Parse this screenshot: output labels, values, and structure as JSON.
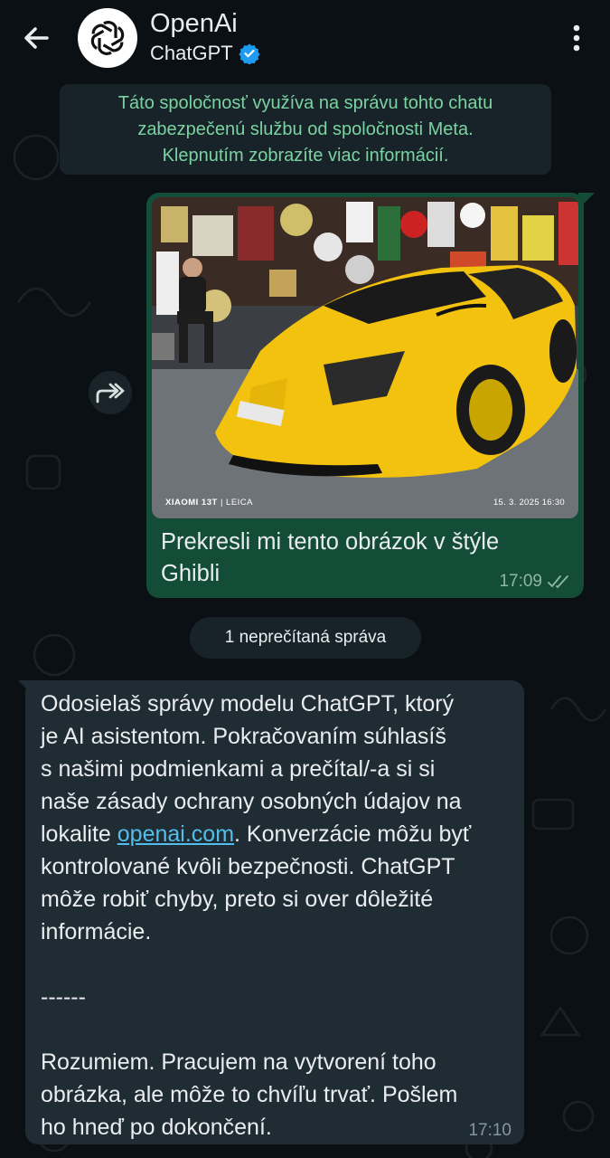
{
  "header": {
    "contact_name": "OpenAi",
    "contact_subtitle": "ChatGPT"
  },
  "notice": {
    "lines": [
      "Táto spoločnosť využíva na správu tohto chatu",
      "zabezpečenú službu od spoločnosti Meta.",
      "Klepnutím zobrazíte viac informácií."
    ]
  },
  "outgoing_message": {
    "photo_watermark_brand": "XIAOMI 13T",
    "photo_watermark_lens": "| LEICA",
    "photo_watermark_date": "15. 3. 2025 16:30",
    "caption_lines": [
      "Prekresli mi tento obrázok v štýle",
      "Ghibli"
    ],
    "time": "17:09"
  },
  "unread_divider": "1 neprečítaná správa",
  "incoming_message": {
    "lines": [
      "Odosielaš správy modelu ChatGPT, ktorý",
      "je AI asistentom. Pokračovaním súhlasíš",
      "s našimi podmienkami a prečítal/-a si si",
      "naše zásady ochrany osobných údajov na"
    ],
    "line5_prefix": "lokalite ",
    "link_text": "openai.com",
    "line5_suffix": ". Konverzácie môžu byť",
    "lines_after": [
      "kontrolované kvôli bezpečnosti. ChatGPT",
      "môže robiť chyby, preto si over dôležité",
      "informácie."
    ],
    "separator": "------",
    "reply_lines": [
      "Rozumiem. Pracujem na vytvorení toho",
      "obrázka, ale môže to chvíľu trvať. Pošlem",
      "ho hneď po dokončení."
    ],
    "time": "17:10"
  },
  "colors": {
    "background": "#0b1014",
    "outgoing_bubble": "#144d37",
    "incoming_bubble": "#202c33",
    "notice_text": "#7ad3a0",
    "link": "#53bdeb"
  },
  "icons": [
    "arrow-left-icon",
    "openai-logo-icon",
    "verified-badge-icon",
    "more-vert-icon",
    "forward-icon",
    "double-check-icon"
  ]
}
